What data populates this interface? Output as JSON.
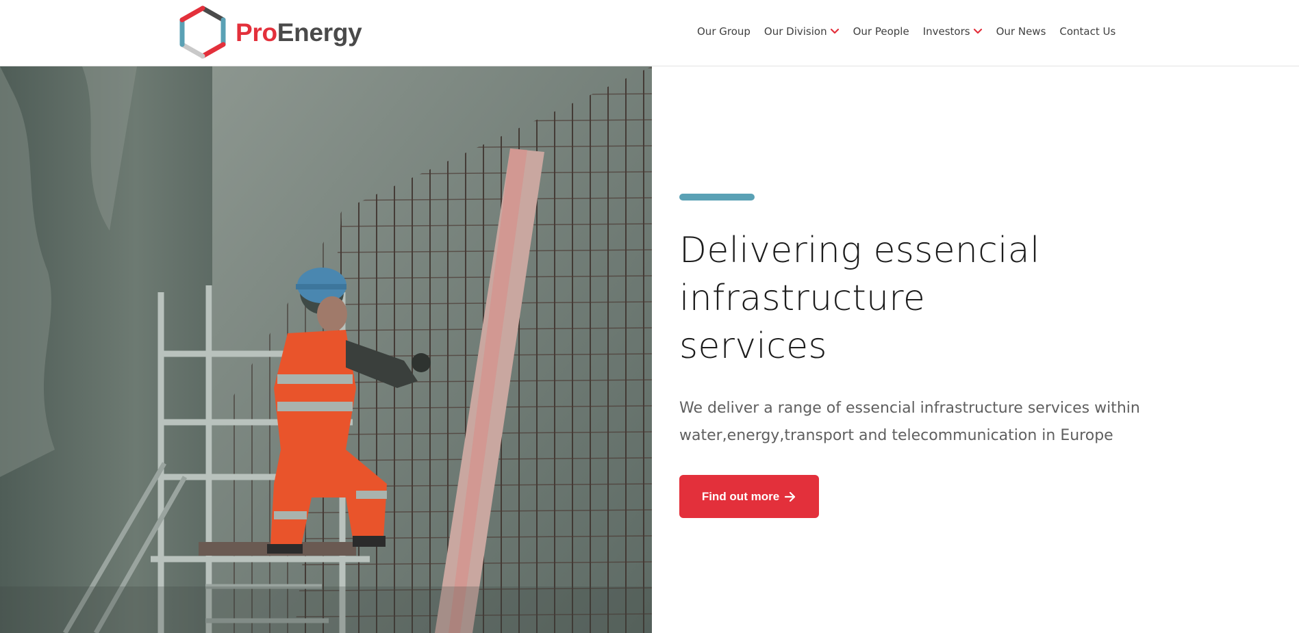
{
  "brand": {
    "name_prefix": "Pro",
    "name_suffix": "Energy",
    "colors": {
      "red": "#e3303b",
      "teal": "#5aa1b5",
      "grey": "#4a4a4a"
    }
  },
  "nav": {
    "items": [
      {
        "label": "Our Group",
        "has_dropdown": false
      },
      {
        "label": "Our Division",
        "has_dropdown": true,
        "icon": "chevron-down-icon"
      },
      {
        "label": "Our People",
        "has_dropdown": false
      },
      {
        "label": "Investors",
        "has_dropdown": true,
        "icon": "chevron-down-icon"
      },
      {
        "label": "Our News",
        "has_dropdown": false
      },
      {
        "label": "Contact Us",
        "has_dropdown": false
      }
    ]
  },
  "hero": {
    "title_lines": [
      "Delivering essencial",
      "infrastructure",
      "services"
    ],
    "text_lines": [
      "We deliver a range of essencial infrastructure services within",
      "water,energy,transport and telecommunication in Europe"
    ],
    "cta_label": "Find out more",
    "cta_icon": "arrow-right-icon"
  }
}
